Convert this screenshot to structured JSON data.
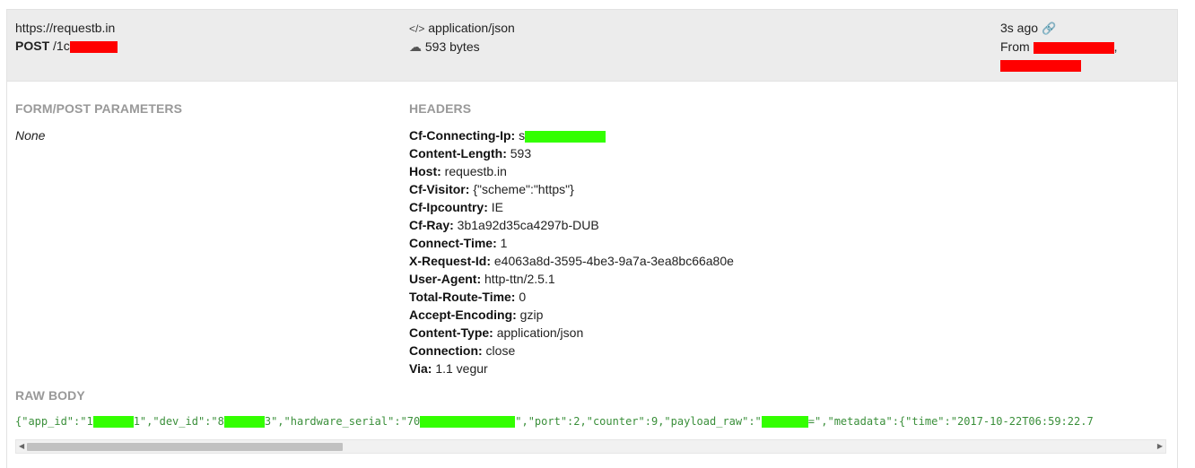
{
  "request": {
    "host": "https://requestb.in",
    "method": "POST",
    "path_prefix": "/1c",
    "content_type": "application/json",
    "size": "593 bytes",
    "age": "3s ago",
    "from_label": "From",
    "from_suffix": ","
  },
  "icons": {
    "code": "</>",
    "cloud": "☁",
    "link": "🔗"
  },
  "form_section": {
    "title": "FORM/POST PARAMETERS",
    "value": "None"
  },
  "headers_section": {
    "title": "HEADERS",
    "items": [
      {
        "key": "Cf-Connecting-Ip:",
        "value": "s"
      },
      {
        "key": "Content-Length:",
        "value": "593"
      },
      {
        "key": "Host:",
        "value": "requestb.in"
      },
      {
        "key": "Cf-Visitor:",
        "value": "{\"scheme\":\"https\"}"
      },
      {
        "key": "Cf-Ipcountry:",
        "value": "IE"
      },
      {
        "key": "Cf-Ray:",
        "value": "3b1a92d35ca4297b-DUB"
      },
      {
        "key": "Connect-Time:",
        "value": "1"
      },
      {
        "key": "X-Request-Id:",
        "value": "e4063a8d-3595-4be3-9a7a-3ea8bc66a80e"
      },
      {
        "key": "User-Agent:",
        "value": "http-ttn/2.5.1"
      },
      {
        "key": "Total-Route-Time:",
        "value": "0"
      },
      {
        "key": "Accept-Encoding:",
        "value": "gzip"
      },
      {
        "key": "Content-Type:",
        "value": "application/json"
      },
      {
        "key": "Connection:",
        "value": "close"
      },
      {
        "key": "Via:",
        "value": "1.1 vegur"
      }
    ]
  },
  "raw_body": {
    "title": "RAW BODY",
    "p1": "{\"app_id\":\"1",
    "p2": "1\",\"dev_id\":\"8",
    "p3": "3\",\"hardware_serial\":\"70",
    "p4": "\",\"port\":2,\"counter\":9,\"payload_raw\":\"",
    "p5": "=\",\"metadata\":{\"time\":\"2017-10-22T06:59:22.7"
  },
  "colors": {
    "redaction_red": "#ff0000",
    "redaction_green": "#33ff00",
    "header_bg": "#ececec",
    "section_title": "#999999",
    "json_text": "#3a8f3a",
    "link_blue": "#3b7dd8"
  }
}
